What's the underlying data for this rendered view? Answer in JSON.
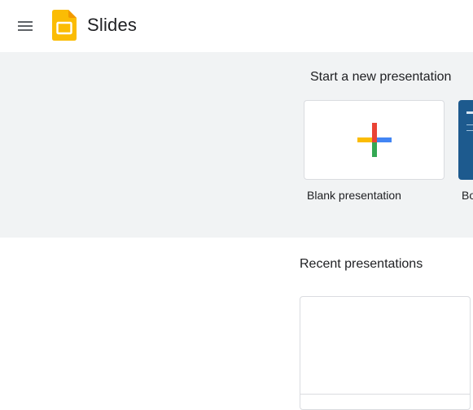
{
  "header": {
    "app_name": "Slides",
    "menu_icon": "hamburger-menu-icon",
    "logo_icon": "slides-logo-icon",
    "logo_color": "#FBBC04"
  },
  "templates": {
    "section_title": "Start a new presentation",
    "items": [
      {
        "label": "Blank presentation",
        "icon": "multicolor-plus-icon"
      },
      {
        "label": "Bo"
      }
    ]
  },
  "recent": {
    "section_title": "Recent presentations"
  },
  "colors": {
    "band_background": "#f1f3f4",
    "plus_red": "#EA4335",
    "plus_blue": "#4285F4",
    "plus_green": "#34A853",
    "plus_yellow": "#FBBC04",
    "template_blue": "#1d5a8e"
  }
}
